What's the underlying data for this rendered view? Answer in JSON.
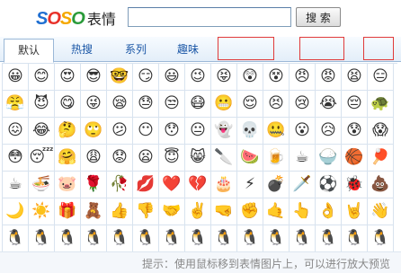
{
  "header": {
    "logo_letters": [
      "S",
      "O",
      "S",
      "O"
    ],
    "logo_colors": [
      "#1f6fd1",
      "#e8312a",
      "#f5a800",
      "#2a9b3a"
    ],
    "logo_word": "表情",
    "search_value": "",
    "search_button": "搜 索"
  },
  "tabs": [
    {
      "label": "默认",
      "active": true
    },
    {
      "label": "热搜",
      "active": false
    },
    {
      "label": "系列",
      "active": false
    },
    {
      "label": "趣味",
      "active": false
    }
  ],
  "emoticons": {
    "rows": [
      [
        "😀",
        "😊",
        "😍",
        "😎",
        "🤓",
        "😏",
        "😃",
        "😉",
        "😝",
        "😲",
        "😵",
        "😠",
        "😡",
        "😫",
        "😑"
      ],
      [
        "😤",
        "😈",
        "😋",
        "😜",
        "😪",
        "😓",
        "😒",
        "😷",
        "😬",
        "😌",
        "😣",
        "😢",
        "😭",
        "😔",
        "🐢"
      ],
      [
        "😖",
        "😂",
        "🤔",
        "🙄",
        "😕",
        "😶",
        "😯",
        "😐",
        "👻",
        "💀",
        "🤐",
        "😮",
        "😥",
        "😰",
        "😱"
      ],
      [
        "😳",
        "😴",
        "🤗",
        "😩",
        "😟",
        "😦",
        "😇",
        "😸",
        "🔪",
        "🍉",
        "🍺",
        "☕",
        "🍚",
        "🏀",
        "🏓"
      ],
      [
        "☕",
        "🍜",
        "🐷",
        "🌹",
        "🥀",
        "💋",
        "❤️",
        "💔",
        "🎂",
        "⚡",
        "💣",
        "🗡️",
        "⚽",
        "🐞",
        "💩"
      ],
      [
        "🌙",
        "☀️",
        "🎁",
        "🧸",
        "👍",
        "👎",
        "🤝",
        "✌️",
        "🤜",
        "✊",
        "🤙",
        "👆",
        "👌",
        "🤘",
        "👋"
      ],
      [
        "🐧",
        "🐧",
        "🐧",
        "🐧",
        "🐧",
        "🐧",
        "🐧",
        "🐧",
        "🐧",
        "🐧",
        "🐧",
        "🐧",
        "🐧",
        "🐧",
        "🐧"
      ]
    ]
  },
  "footer": {
    "hint": "提示：使用鼠标移到表情图片上，可以进行放大预览"
  },
  "colors": {
    "accent": "#1a56a6",
    "tab_border": "#9bb8d7",
    "highlight": "#e03a3a"
  }
}
